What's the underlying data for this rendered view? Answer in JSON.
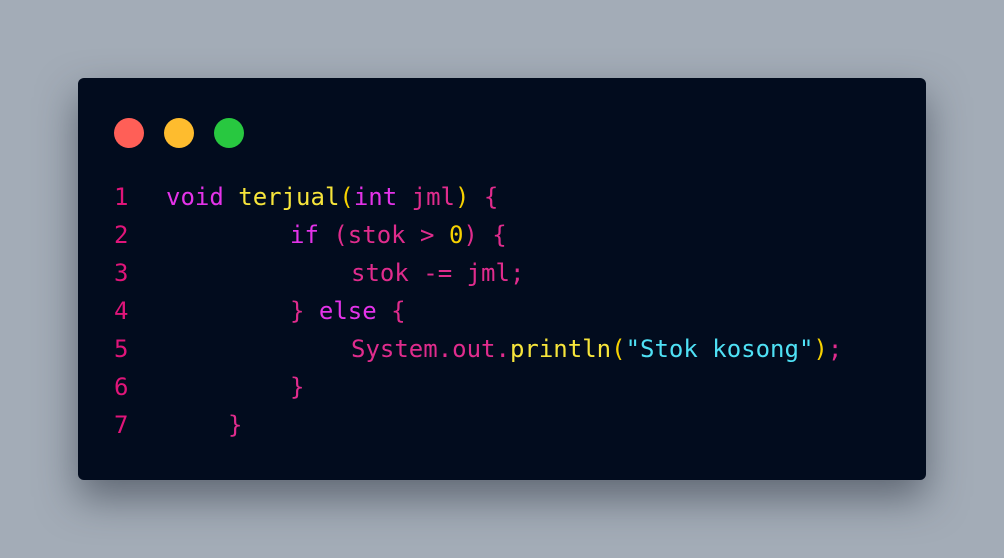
{
  "colors": {
    "background": "#a3acb7",
    "editor_background": "#020c1e",
    "dot_red": "#ff5f57",
    "dot_yellow": "#febc2e",
    "dot_green": "#28c840",
    "line_number": "#e0157a",
    "keyword": "#e433e9",
    "function": "#f7e53b",
    "paren": "#f7d200",
    "variable": "#e02c8d",
    "brace": "#e02c8d",
    "number": "#f7d200",
    "string": "#4fe1f5"
  },
  "window_controls": [
    "close-dot",
    "minimize-dot",
    "maximize-dot"
  ],
  "code": {
    "lines": [
      {
        "number": "1",
        "indent": 0,
        "tokens": [
          {
            "text": "void ",
            "type": "keyword"
          },
          {
            "text": "terjual",
            "type": "function"
          },
          {
            "text": "(",
            "type": "paren"
          },
          {
            "text": "int ",
            "type": "keyword"
          },
          {
            "text": "jml",
            "type": "variable"
          },
          {
            "text": ")",
            "type": "paren"
          },
          {
            "text": " {",
            "type": "brace"
          }
        ]
      },
      {
        "number": "2",
        "indent": 124,
        "tokens": [
          {
            "text": "if ",
            "type": "keyword"
          },
          {
            "text": "(stok > ",
            "type": "variable"
          },
          {
            "text": "0",
            "type": "number"
          },
          {
            "text": ") {",
            "type": "variable"
          }
        ]
      },
      {
        "number": "3",
        "indent": 185,
        "tokens": [
          {
            "text": "stok -= jml;",
            "type": "variable"
          }
        ]
      },
      {
        "number": "4",
        "indent": 124,
        "tokens": [
          {
            "text": "} ",
            "type": "brace"
          },
          {
            "text": "else",
            "type": "keyword"
          },
          {
            "text": " {",
            "type": "brace"
          }
        ]
      },
      {
        "number": "5",
        "indent": 185,
        "tokens": [
          {
            "text": "System.out.",
            "type": "variable"
          },
          {
            "text": "println",
            "type": "function"
          },
          {
            "text": "(",
            "type": "paren"
          },
          {
            "text": "\"Stok kosong\"",
            "type": "string"
          },
          {
            "text": ")",
            "type": "paren"
          },
          {
            "text": ";",
            "type": "variable"
          }
        ]
      },
      {
        "number": "6",
        "indent": 124,
        "tokens": [
          {
            "text": "}",
            "type": "brace"
          }
        ]
      },
      {
        "number": "7",
        "indent": 62,
        "tokens": [
          {
            "text": "}",
            "type": "brace"
          }
        ]
      }
    ]
  }
}
